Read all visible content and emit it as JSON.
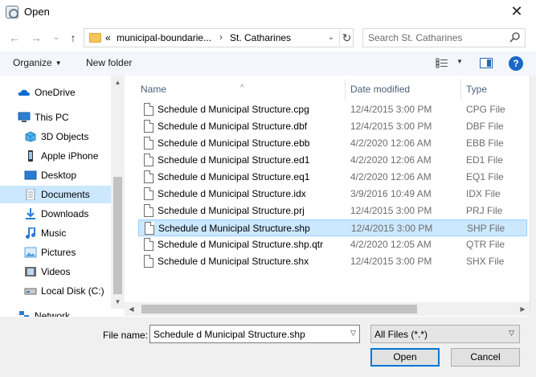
{
  "window": {
    "title": "Open"
  },
  "nav": {
    "back": "←",
    "forward": "→",
    "recent": "⌄",
    "up": "↑",
    "address": {
      "overflow": "«",
      "crumbs": [
        "municipal-boundarie...",
        "St. Catharines"
      ],
      "sep": "›",
      "dropdown": "⌄",
      "refresh": "↻"
    },
    "search_placeholder": "Search St. Catharines"
  },
  "toolbar": {
    "organize": "Organize",
    "new_folder": "New folder",
    "help": "?"
  },
  "sidebar": {
    "items": [
      {
        "label": "OneDrive",
        "icon": "onedrive-icon",
        "color": "#0a6ed1"
      },
      {
        "label": "This PC",
        "icon": "this-pc-icon",
        "color": "#2d7fd0"
      },
      {
        "label": "3D Objects",
        "icon": "3d-objects-icon",
        "color": "#4fb0e8"
      },
      {
        "label": "Apple iPhone",
        "icon": "phone-icon",
        "color": "#333333"
      },
      {
        "label": "Desktop",
        "icon": "desktop-icon",
        "color": "#2a7bd4"
      },
      {
        "label": "Documents",
        "icon": "documents-icon",
        "color": "#7f8fa3"
      },
      {
        "label": "Downloads",
        "icon": "downloads-icon",
        "color": "#2a7bd4"
      },
      {
        "label": "Music",
        "icon": "music-icon",
        "color": "#2a7bd4"
      },
      {
        "label": "Pictures",
        "icon": "pictures-icon",
        "color": "#5aa2d8"
      },
      {
        "label": "Videos",
        "icon": "videos-icon",
        "color": "#6b6b6b"
      },
      {
        "label": "Local Disk (C:)",
        "icon": "local-disk-icon",
        "color": "#6b6b6b"
      },
      {
        "label": "Network",
        "icon": "network-icon",
        "color": "#2a7bd4"
      }
    ],
    "selected": "Documents"
  },
  "files": {
    "columns": {
      "name": "Name",
      "date": "Date modified",
      "type": "Type"
    },
    "rows": [
      {
        "name": "Schedule d Municipal Structure.cpg",
        "date": "12/4/2015 3:00 PM",
        "type": "CPG File"
      },
      {
        "name": "Schedule d Municipal Structure.dbf",
        "date": "12/4/2015 3:00 PM",
        "type": "DBF File"
      },
      {
        "name": "Schedule d Municipal Structure.ebb",
        "date": "4/2/2020 12:06 AM",
        "type": "EBB File"
      },
      {
        "name": "Schedule d Municipal Structure.ed1",
        "date": "4/2/2020 12:06 AM",
        "type": "ED1 File"
      },
      {
        "name": "Schedule d Municipal Structure.eq1",
        "date": "4/2/2020 12:06 AM",
        "type": "EQ1 File"
      },
      {
        "name": "Schedule d Municipal Structure.idx",
        "date": "3/9/2016 10:49 AM",
        "type": "IDX File"
      },
      {
        "name": "Schedule d Municipal Structure.prj",
        "date": "12/4/2015 3:00 PM",
        "type": "PRJ File"
      },
      {
        "name": "Schedule d Municipal Structure.shp",
        "date": "12/4/2015 3:00 PM",
        "type": "SHP File"
      },
      {
        "name": "Schedule d Municipal Structure.shp.qtr",
        "date": "4/2/2020 12:05 AM",
        "type": "QTR File"
      },
      {
        "name": "Schedule d Municipal Structure.shx",
        "date": "12/4/2015 3:00 PM",
        "type": "SHX File"
      }
    ],
    "selected": "Schedule d Municipal Structure.shp"
  },
  "footer": {
    "file_name_label": "File name:",
    "file_name_value": "Schedule d Municipal Structure.shp",
    "filter_value": "All Files (*.*)",
    "open_label": "Open",
    "cancel_label": "Cancel"
  },
  "colors": {
    "selection": "#cce8ff",
    "accent": "#0078d7",
    "toolbar_bg": "#f3f6fb"
  }
}
